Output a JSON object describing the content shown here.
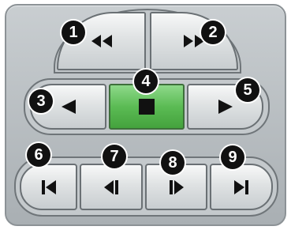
{
  "badges": [
    "1",
    "2",
    "3",
    "4",
    "5",
    "6",
    "7",
    "8",
    "9"
  ],
  "buttons": {
    "rewind": {
      "icon": "rewind-icon"
    },
    "fast_forward": {
      "icon": "fast-forward-icon"
    },
    "step_back": {
      "icon": "triangle-left-icon"
    },
    "stop": {
      "icon": "stop-square-icon"
    },
    "step_forward": {
      "icon": "triangle-right-icon"
    },
    "go_first": {
      "icon": "skip-to-start-icon"
    },
    "previous": {
      "icon": "previous-frame-icon"
    },
    "next": {
      "icon": "next-frame-icon"
    },
    "go_last": {
      "icon": "skip-to-end-icon"
    }
  },
  "colors": {
    "panel": "#b6bcc0",
    "stop_green": "#5bbb54",
    "icon": "#111111"
  }
}
